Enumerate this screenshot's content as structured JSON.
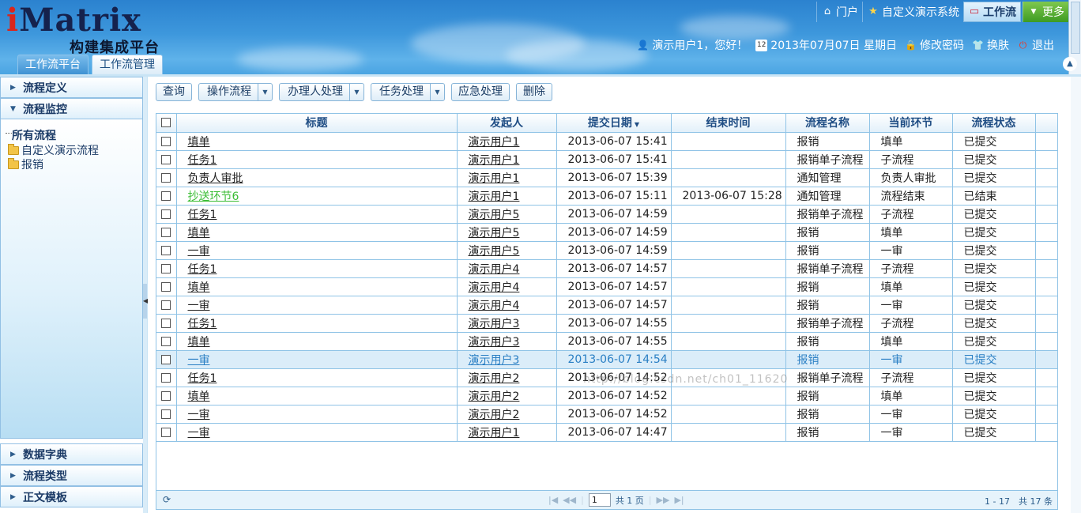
{
  "header": {
    "logo_main_i": "i",
    "logo_main_rest": "Matrix",
    "logo_sub": "构建集成平台",
    "top_nav": [
      {
        "icon": "home-icon",
        "glyph": "⌂",
        "label": "门户"
      },
      {
        "icon": "star-icon",
        "glyph": "★",
        "label": "自定义演示系统"
      },
      {
        "icon": "workflow-icon",
        "glyph": "▭",
        "label": "工作流"
      },
      {
        "icon": "chevron-down-icon",
        "glyph": "▼",
        "label": "更多"
      }
    ],
    "user_bar": {
      "greeting": "演示用户1，您好！",
      "date": "2013年07月07日 星期日",
      "change_password": "修改密码",
      "skin": "换肤",
      "logout": "退出"
    },
    "tabs": [
      "工作流平台",
      "工作流管理"
    ]
  },
  "sidebar": {
    "sections": [
      {
        "label": "流程定义",
        "expanded": false
      },
      {
        "label": "流程监控",
        "expanded": true
      }
    ],
    "tree": {
      "root": "所有流程",
      "children": [
        "自定义演示流程",
        "报销"
      ]
    },
    "bottom_sections": [
      "数据字典",
      "流程类型",
      "正文模板"
    ]
  },
  "toolbar": {
    "query": "查询",
    "operate_flow": "操作流程",
    "handler_process": "办理人处理",
    "task_process": "任务处理",
    "emergency": "应急处理",
    "delete": "删除"
  },
  "grid": {
    "columns": [
      "标题",
      "发起人",
      "提交日期",
      "结束时间",
      "流程名称",
      "当前环节",
      "流程状态"
    ],
    "sort_column": "提交日期",
    "rows": [
      {
        "title": "填单",
        "starter": "演示用户1",
        "submit": "2013-06-07 15:41",
        "end": "",
        "process": "报销",
        "node": "填单",
        "status": "已提交"
      },
      {
        "title": "任务1",
        "starter": "演示用户1",
        "submit": "2013-06-07 15:41",
        "end": "",
        "process": "报销单子流程",
        "node": "子流程",
        "status": "已提交"
      },
      {
        "title": "负责人审批",
        "starter": "演示用户1",
        "submit": "2013-06-07 15:39",
        "end": "",
        "process": "通知管理",
        "node": "负责人审批",
        "status": "已提交"
      },
      {
        "title": "抄送环节6",
        "starter": "演示用户1",
        "submit": "2013-06-07 15:11",
        "end": "2013-06-07 15:28",
        "process": "通知管理",
        "node": "流程结束",
        "status": "已结束",
        "style": "green"
      },
      {
        "title": "任务1",
        "starter": "演示用户5",
        "submit": "2013-06-07 14:59",
        "end": "",
        "process": "报销单子流程",
        "node": "子流程",
        "status": "已提交"
      },
      {
        "title": "填单",
        "starter": "演示用户5",
        "submit": "2013-06-07 14:59",
        "end": "",
        "process": "报销",
        "node": "填单",
        "status": "已提交"
      },
      {
        "title": "一审",
        "starter": "演示用户5",
        "submit": "2013-06-07 14:59",
        "end": "",
        "process": "报销",
        "node": "一审",
        "status": "已提交"
      },
      {
        "title": "任务1",
        "starter": "演示用户4",
        "submit": "2013-06-07 14:57",
        "end": "",
        "process": "报销单子流程",
        "node": "子流程",
        "status": "已提交"
      },
      {
        "title": "填单",
        "starter": "演示用户4",
        "submit": "2013-06-07 14:57",
        "end": "",
        "process": "报销",
        "node": "填单",
        "status": "已提交"
      },
      {
        "title": "一审",
        "starter": "演示用户4",
        "submit": "2013-06-07 14:57",
        "end": "",
        "process": "报销",
        "node": "一审",
        "status": "已提交"
      },
      {
        "title": "任务1",
        "starter": "演示用户3",
        "submit": "2013-06-07 14:55",
        "end": "",
        "process": "报销单子流程",
        "node": "子流程",
        "status": "已提交"
      },
      {
        "title": "填单",
        "starter": "演示用户3",
        "submit": "2013-06-07 14:55",
        "end": "",
        "process": "报销",
        "node": "填单",
        "status": "已提交"
      },
      {
        "title": "一审",
        "starter": "演示用户3",
        "submit": "2013-06-07 14:54",
        "end": "",
        "process": "报销",
        "node": "一审",
        "status": "已提交",
        "style": "selected"
      },
      {
        "title": "任务1",
        "starter": "演示用户2",
        "submit": "2013-06-07 14:52",
        "end": "",
        "process": "报销单子流程",
        "node": "子流程",
        "status": "已提交"
      },
      {
        "title": "填单",
        "starter": "演示用户2",
        "submit": "2013-06-07 14:52",
        "end": "",
        "process": "报销",
        "node": "填单",
        "status": "已提交"
      },
      {
        "title": "一审",
        "starter": "演示用户2",
        "submit": "2013-06-07 14:52",
        "end": "",
        "process": "报销",
        "node": "一审",
        "status": "已提交"
      },
      {
        "title": "一审",
        "starter": "演示用户1",
        "submit": "2013-06-07 14:47",
        "end": "",
        "process": "报销",
        "node": "一审",
        "status": "已提交"
      }
    ]
  },
  "pager": {
    "page_value": "1",
    "total_pages_text": "共 1 页",
    "summary": "1 - 17　共 17 条"
  },
  "watermark": "http://blog.csdn.net/ch01_11620"
}
